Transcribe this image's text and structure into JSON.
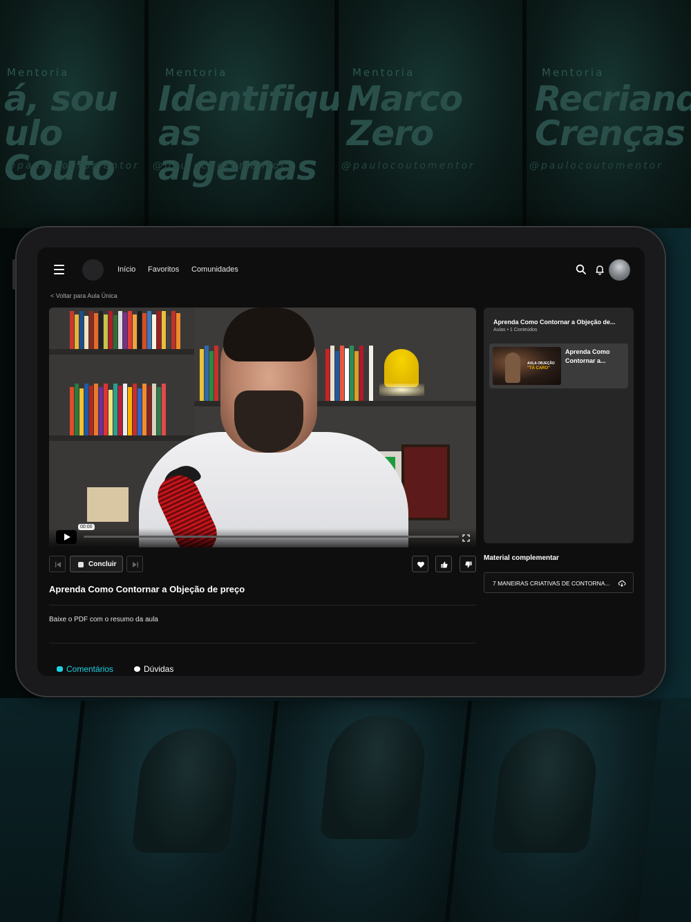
{
  "background": {
    "posters": [
      {
        "tag": "Mentoria",
        "line1": "á, sou",
        "line2": "ulo Couto",
        "handle": "@paulocoutomentor"
      },
      {
        "tag": "Mentoria",
        "line1": "Identifique",
        "line2": "as algemas",
        "handle": "@paulocoutomentor"
      },
      {
        "tag": "Mentoria",
        "line1": "Marco",
        "line2": "Zero",
        "handle": "@paulocoutomentor"
      },
      {
        "tag": "Mentoria",
        "line1": "Recriando",
        "line2": "Crenças",
        "handle": "@paulocoutomentor"
      }
    ]
  },
  "nav": {
    "links": [
      "Início",
      "Favoritos",
      "Comunidades"
    ],
    "icons": {
      "menu": "hamburger-menu-icon",
      "search": "search-icon",
      "notifications": "bell-icon"
    }
  },
  "back_link": "< Voltar para Aula Única",
  "video": {
    "current_time": "00:00",
    "progress": 0.0
  },
  "playlist": {
    "title": "Aprenda Como Contornar a Objeção de...",
    "subtitle": "Aulas • 1 Conteúdos",
    "items": [
      {
        "label": "Aprenda Como Contornar a...",
        "thumb_line1": "AULA OBJEÇÃO",
        "thumb_line2": "\"TÁ CARO\""
      }
    ]
  },
  "controls": {
    "conclude_label": "Concluir"
  },
  "lesson": {
    "title": "Aprenda Como Contornar a Objeção de preço",
    "description": "Baixe o PDF com o resumo da aula"
  },
  "material": {
    "title": "Material complementar",
    "file_label": "7 MANEIRAS CRIATIVAS DE CONTORNA..."
  },
  "tabs": {
    "comments": "Comentários",
    "questions": "Dúvidas"
  },
  "colors": {
    "accent": "#1fd1e0",
    "screen_bg": "#0e0e0f",
    "panel_bg": "#262627"
  }
}
